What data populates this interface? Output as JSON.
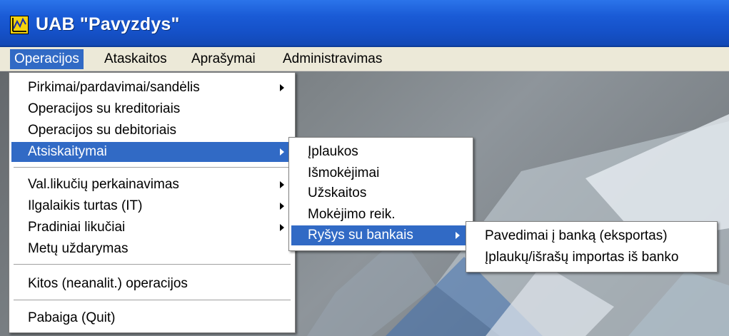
{
  "window": {
    "title": "UAB \"Pavyzdys\""
  },
  "menubar": {
    "items": [
      {
        "label": "Operacijos"
      },
      {
        "label": "Ataskaitos"
      },
      {
        "label": "Aprašymai"
      },
      {
        "label": "Administravimas"
      }
    ]
  },
  "menu_operacijos": {
    "items": [
      {
        "label": "Pirkimai/pardavimai/sandėlis"
      },
      {
        "label": "Operacijos su kreditoriais"
      },
      {
        "label": "Operacijos su debitoriais"
      },
      {
        "label": "Atsiskaitymai"
      },
      {
        "label": "Val.likučių perkainavimas"
      },
      {
        "label": "Ilgalaikis turtas (IT)"
      },
      {
        "label": "Pradiniai likučiai"
      },
      {
        "label": "Metų uždarymas"
      },
      {
        "label": "Kitos (neanalit.) operacijos"
      },
      {
        "label": "Pabaiga (Quit)"
      }
    ]
  },
  "menu_atsiskaitymai": {
    "items": [
      {
        "label": "Įplaukos"
      },
      {
        "label": "Išmokėjimai"
      },
      {
        "label": "Užskaitos"
      },
      {
        "label": "Mokėjimo reik."
      },
      {
        "label": "Ryšys su bankais"
      }
    ]
  },
  "menu_bankai": {
    "items": [
      {
        "label": "Pavedimai į banką (eksportas)"
      },
      {
        "label": "Įplaukų/išrašų importas iš banko"
      }
    ]
  },
  "colors": {
    "highlight": "#316ac5",
    "titlebar": "#1a5bd6",
    "menubar": "#ece9d8"
  }
}
